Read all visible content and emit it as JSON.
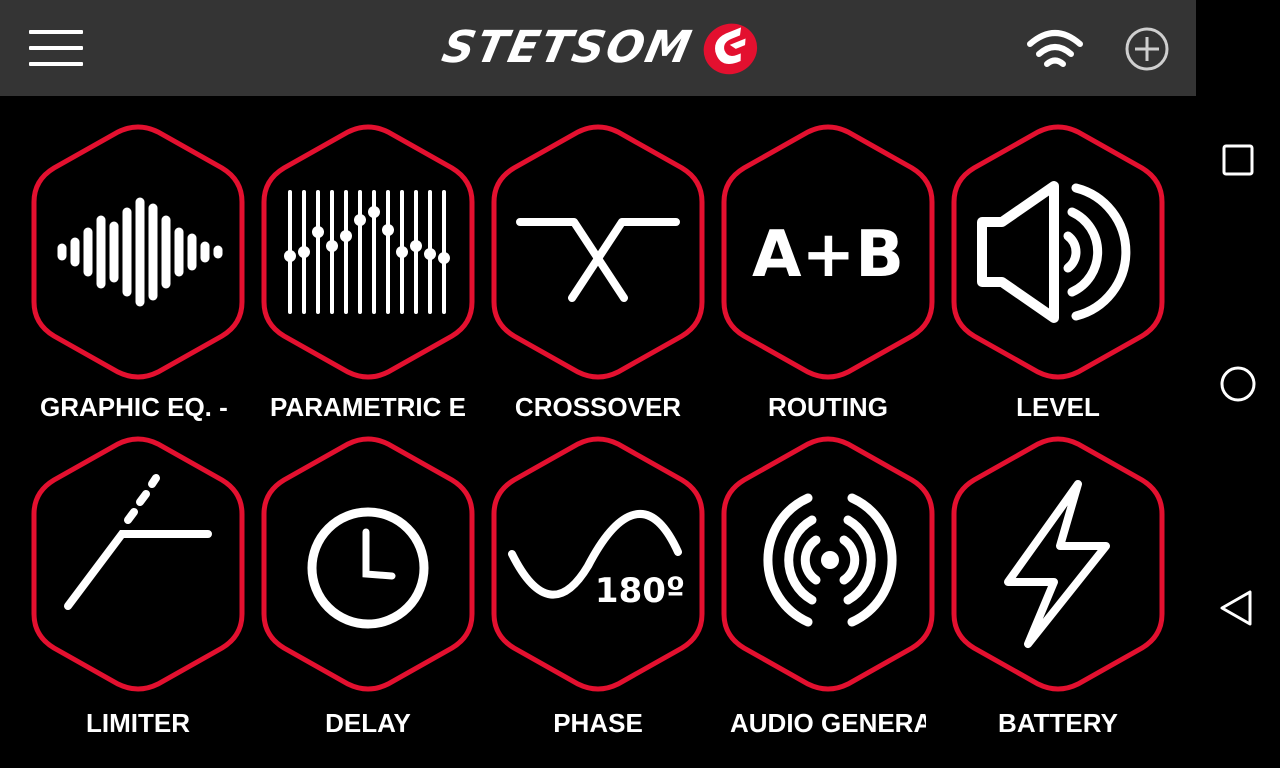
{
  "header": {
    "brand": "STETSOM",
    "menu_icon": "hamburger-menu-icon",
    "wifi_icon": "wifi-icon",
    "add_icon": "add-circle-icon"
  },
  "colors": {
    "accent": "#e3102f",
    "topbar_bg": "#343434",
    "background": "#000000",
    "icon": "#ffffff"
  },
  "tiles": [
    {
      "label": "GRAPHIC EQ. - IN",
      "icon": "waveform-icon"
    },
    {
      "label": "PARAMETRIC EQ.",
      "icon": "equalizer-sliders-icon"
    },
    {
      "label": "CROSSOVER",
      "icon": "crossover-icon"
    },
    {
      "label": "ROUTING",
      "icon": "routing-ab-icon",
      "glyph": "A+B"
    },
    {
      "label": "LEVEL",
      "icon": "speaker-volume-icon"
    },
    {
      "label": "LIMITER",
      "icon": "limiter-curve-icon"
    },
    {
      "label": "DELAY",
      "icon": "clock-icon"
    },
    {
      "label": "PHASE",
      "icon": "phase-sine-icon",
      "glyph": "180º"
    },
    {
      "label": "AUDIO GENERATOR",
      "icon": "audio-generator-icon"
    },
    {
      "label": "BATTERY",
      "icon": "lightning-bolt-icon"
    }
  ],
  "system_nav": {
    "recents_icon": "recent-apps-square-icon",
    "home_icon": "home-circle-icon",
    "back_icon": "back-triangle-icon"
  }
}
